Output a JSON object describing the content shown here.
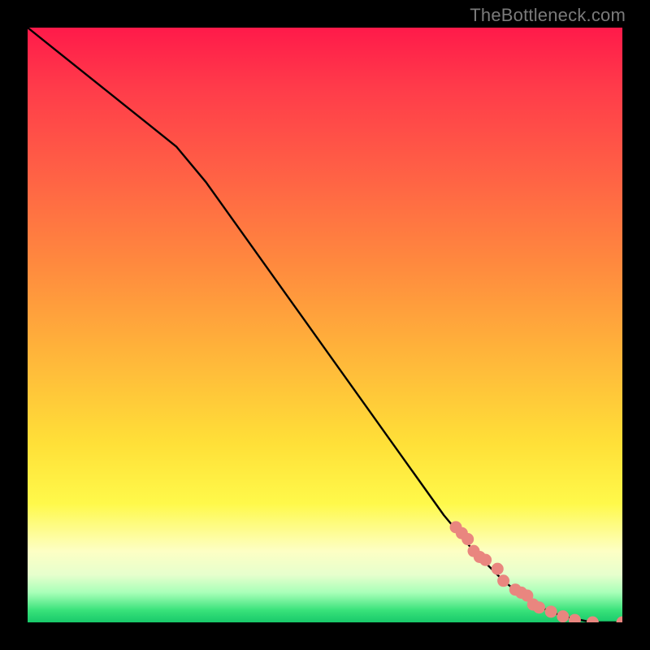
{
  "watermark": "TheBottleneck.com",
  "colors": {
    "curve_stroke": "#000000",
    "marker_fill": "#e9867f",
    "marker_stroke": "#c46b66"
  },
  "chart_data": {
    "type": "line",
    "title": "",
    "xlabel": "",
    "ylabel": "",
    "xlim": [
      0,
      100
    ],
    "ylim": [
      0,
      100
    ],
    "series": [
      {
        "name": "curve",
        "x": [
          0,
          5,
          10,
          15,
          20,
          25,
          30,
          35,
          40,
          45,
          50,
          55,
          60,
          65,
          70,
          75,
          80,
          85,
          90,
          95,
          100
        ],
        "y": [
          100,
          96,
          92,
          88,
          84,
          80,
          74,
          67,
          60,
          53,
          46,
          39,
          32,
          25,
          18,
          12,
          7,
          3,
          1,
          0,
          0
        ]
      }
    ],
    "markers": {
      "name": "highlight-points",
      "x": [
        72,
        73,
        74,
        75,
        76,
        77,
        79,
        80,
        82,
        83,
        84,
        85,
        86,
        88,
        90,
        92,
        95,
        100
      ],
      "y": [
        16.0,
        15.0,
        14.0,
        12.0,
        11.0,
        10.5,
        9.0,
        7.0,
        5.5,
        5.0,
        4.5,
        3.0,
        2.5,
        1.8,
        1.0,
        0.4,
        0.0,
        0.0
      ]
    }
  }
}
